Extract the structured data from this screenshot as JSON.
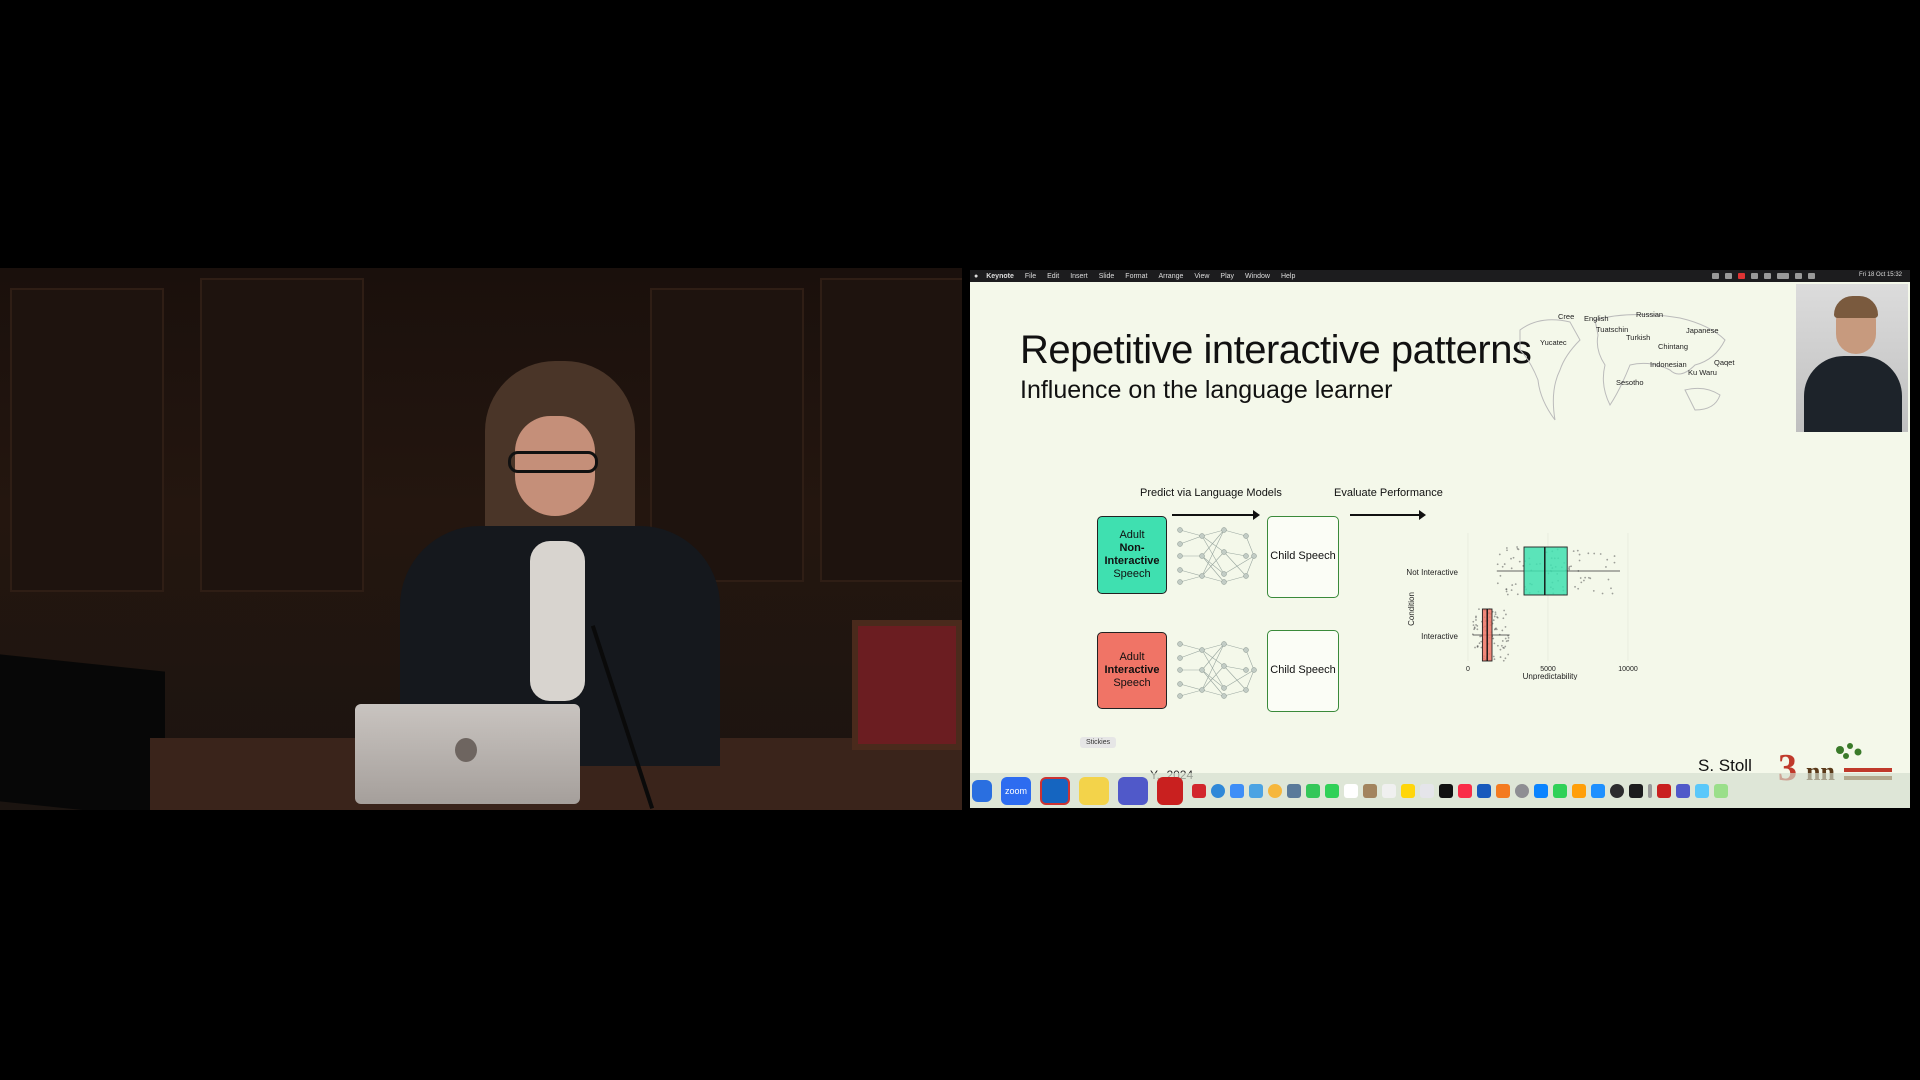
{
  "menubar": {
    "app": "Keynote",
    "items": [
      "File",
      "Edit",
      "Insert",
      "Slide",
      "Format",
      "Arrange",
      "View",
      "Play",
      "Window",
      "Help"
    ],
    "clock": "Fri 18 Oct 15:32"
  },
  "slide": {
    "title": "Repetitive interactive patterns",
    "subtitle": "Influence on the language learner",
    "map_languages": [
      "Cree",
      "English",
      "Russian",
      "Tuatschin",
      "Japanese",
      "Turkish",
      "Yucatec",
      "Chintang",
      "Qaqet",
      "Indonesian",
      "Ku Waru",
      "Sesotho"
    ],
    "diagram": {
      "predict_label": "Predict via Language Models",
      "evaluate_label": "Evaluate Performance",
      "top_input": {
        "line1": "Adult",
        "line2": "Non-",
        "line3": "Interactive",
        "line4": "Speech"
      },
      "bottom_input": {
        "line1": "Adult",
        "line2": "Interactive",
        "line3": "Speech"
      },
      "output_top": "Child Speech",
      "output_bottom": "Child Speech"
    },
    "author": "S. Stoll"
  },
  "chart_data": {
    "type": "box",
    "x_label": "Unpredictability",
    "y_label": "Condition",
    "x_ticks": [
      0,
      5000,
      10000
    ],
    "x_tick_labels": [
      "0",
      "5000",
      "10000"
    ],
    "categories": [
      "Not Interactive",
      "Interactive"
    ],
    "series": [
      {
        "category": "Not Interactive",
        "q1": 3500,
        "median": 4800,
        "q3": 6200,
        "whisker_low": 1800,
        "whisker_high": 9500,
        "color": "#3fe0b0"
      },
      {
        "category": "Interactive",
        "q1": 900,
        "median": 1200,
        "q3": 1500,
        "whisker_low": 300,
        "whisker_high": 2600,
        "color": "#f07466"
      }
    ]
  },
  "dock": {
    "stickies_label": "Stickies",
    "zoom_label": "zoom",
    "ghost_text": "Y...2024"
  }
}
